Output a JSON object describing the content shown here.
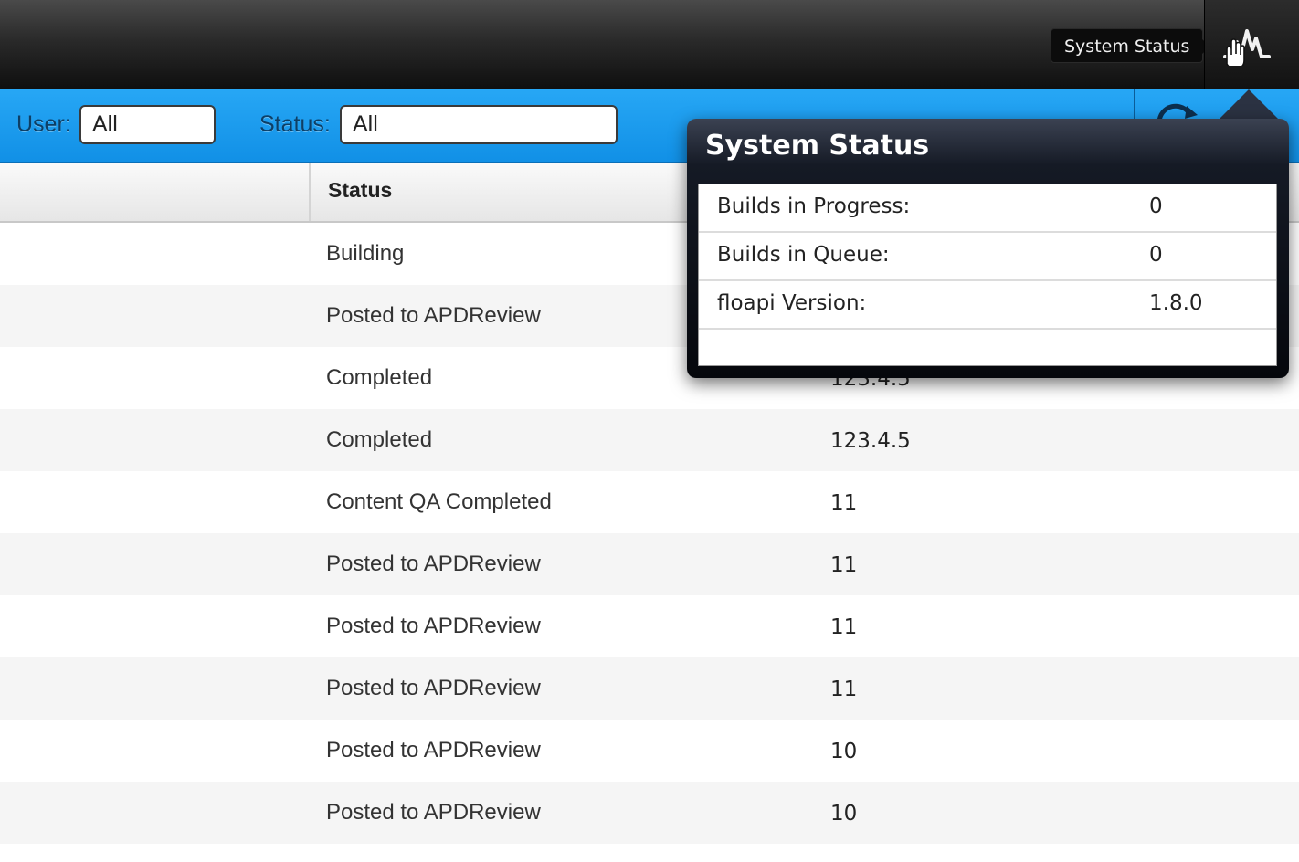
{
  "header": {
    "tooltip": "System Status",
    "status_button_icon": "activity-graph-icon"
  },
  "filters": {
    "user_label": "User:",
    "user_value": "All",
    "status_label": "Status:",
    "status_value": "All",
    "refresh_icon": "refresh-icon"
  },
  "table": {
    "columns": [
      "Status"
    ],
    "rows": [
      {
        "status": "Building",
        "version": ""
      },
      {
        "status": "Posted to APDReview",
        "version": ""
      },
      {
        "status": "Completed",
        "version": "123.4.5"
      },
      {
        "status": "Completed",
        "version": "123.4.5"
      },
      {
        "status": "Content QA Completed",
        "version": "11"
      },
      {
        "status": "Posted to APDReview",
        "version": "11"
      },
      {
        "status": "Posted to APDReview",
        "version": "11"
      },
      {
        "status": "Posted to APDReview",
        "version": "11"
      },
      {
        "status": "Posted to APDReview",
        "version": "10"
      },
      {
        "status": "Posted to APDReview",
        "version": "10"
      }
    ]
  },
  "system_status": {
    "title": "System Status",
    "items": [
      {
        "label": "Builds in Progress:",
        "value": "0"
      },
      {
        "label": "Builds in Queue:",
        "value": "0"
      },
      {
        "label": "floapi Version:",
        "value": "1.8.0"
      }
    ]
  },
  "colors": {
    "accent_blue": "#1a9cf0",
    "topbar_dark": "#1a1a1a",
    "popover_dark": "#0a0d14"
  }
}
